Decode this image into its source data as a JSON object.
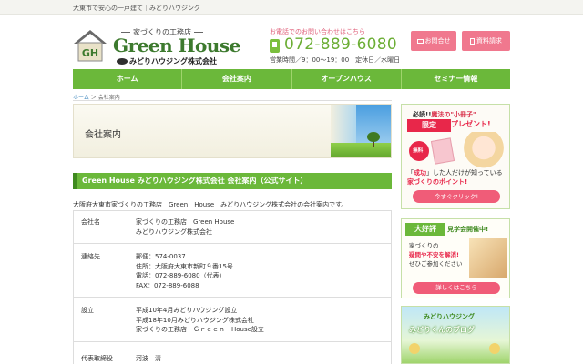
{
  "topbar": {
    "text": "大東市で安心の一戸建て｜みどりハウジング"
  },
  "logo": {
    "badge": "GH",
    "tagline": "家づくりの工務店",
    "name": "Green House",
    "company": "みどりハウジング株式会社"
  },
  "contact": {
    "lead": "お電話でのお問い合わせはこちら",
    "phone": "072-889-6080",
    "hours": "営業時間／9：00～19：00　定休日／水曜日"
  },
  "header_buttons": {
    "inquiry": "お問合せ",
    "documents": "資料請求"
  },
  "nav": [
    "ホーム",
    "会社案内",
    "オープンハウス",
    "セミナー情報"
  ],
  "breadcrumb": {
    "home": "ホーム",
    "separator": "＞",
    "current": "会社案内"
  },
  "hero": {
    "title": "会社案内"
  },
  "section": {
    "title": "Green House みどりハウジング株式会社 会社案内（公式サイト）",
    "intro": "大阪府大東市家づくりの工務店　Green　House　みどりハウジング株式会社の会社案内です。"
  },
  "company_table": [
    {
      "label": "会社名",
      "lines": [
        "家づくりの工務店　Green House",
        "みどりハウジング株式会社"
      ]
    },
    {
      "label": "連絡先",
      "lines": [
        "郵便：574-0037",
        "住所：大阪府大東市新町９番15号",
        "電話：072-889-6080（代表）",
        "FAX：072-889-6088"
      ]
    },
    {
      "label": "設立",
      "lines": [
        "平成10年4月みどりハウジング設立",
        "平成18年10月みどりハウジング株式会社",
        "家づくりの工務店　Ｇｒｅｅｎ　House設立"
      ]
    },
    {
      "label": "代表取締役",
      "lines": [
        "河波　清"
      ]
    }
  ],
  "sidebar": {
    "present": {
      "must_pre": "必読!!",
      "must_hl": "魔法の\"小冊子\"",
      "gift_a": "限定",
      "gift_b": "プレゼント!",
      "burst": "無料!",
      "copy1_pre": "「",
      "copy1_hl": "成功",
      "copy1_post": "」した人だけが知っている",
      "copy2_hl": "家づくりのポイント!",
      "button": "今すぐクリック!"
    },
    "openhouse": {
      "big": "大好評",
      "open": "見学会開催中!",
      "line1": "家づくりの",
      "line2_hl": "疑問や不安を解消!",
      "line3": "ぜひご参加ください",
      "button": "詳しくはこちら"
    },
    "blog": {
      "brand": "みどりハウジング",
      "title": "みどりくんのブログ"
    }
  },
  "colors": {
    "green": "#6bb83a",
    "pink": "#f0788e",
    "red": "#e8274a"
  }
}
